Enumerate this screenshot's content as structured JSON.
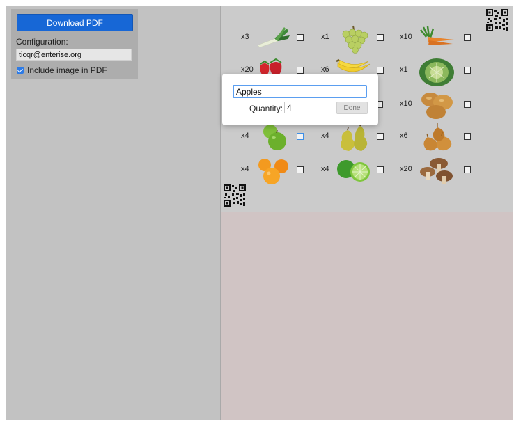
{
  "config": {
    "download_label": "Download PDF",
    "config_label": "Configuration:",
    "config_value": "ticqr@enterise.org",
    "include_image_label": "Include image in PDF",
    "include_image_checked": true
  },
  "grid": {
    "rows": [
      [
        {
          "qty": "x3",
          "icon": "leek-icon"
        },
        {
          "qty": "x1",
          "icon": "grapes-icon"
        },
        {
          "qty": "x10",
          "icon": "carrots-icon"
        }
      ],
      [
        {
          "qty": "x20",
          "icon": "strawberries-icon"
        },
        {
          "qty": "x6",
          "icon": "bananas-icon"
        },
        {
          "qty": "x1",
          "icon": "cabbage-icon"
        }
      ],
      [
        {
          "qty": "",
          "icon": ""
        },
        {
          "qty": "",
          "icon": ""
        },
        {
          "qty": "x10",
          "icon": "potatoes-icon"
        }
      ],
      [
        {
          "qty": "x4",
          "icon": "apples-icon"
        },
        {
          "qty": "x4",
          "icon": "pears-icon"
        },
        {
          "qty": "x6",
          "icon": "onions-icon"
        }
      ],
      [
        {
          "qty": "x4",
          "icon": "oranges-icon"
        },
        {
          "qty": "x4",
          "icon": "limes-icon"
        },
        {
          "qty": "x20",
          "icon": "mushrooms-icon"
        }
      ]
    ]
  },
  "popup": {
    "name_value": "Apples",
    "quantity_label": "Quantity:",
    "quantity_value": "4",
    "done_label": "Done"
  },
  "colors": {
    "accent": "#1767d6",
    "focus": "#5b9ef0"
  }
}
